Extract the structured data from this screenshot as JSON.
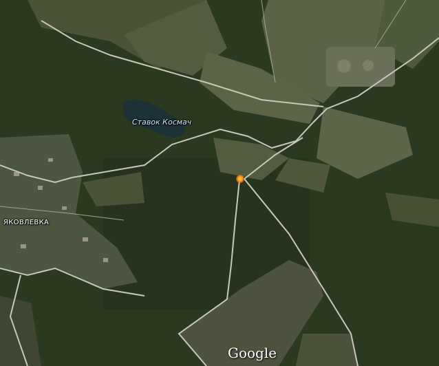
{
  "map": {
    "labels": {
      "water_body": "Ставок Космач",
      "village": "ЯКОВЛЕВКА"
    },
    "marker": {
      "icon": "location-marker-icon",
      "color": "#ff8a1a"
    },
    "attribution": "Google",
    "colors": {
      "forest": "#2d3a22",
      "field_light": "#5b6548",
      "field_dark": "#434c35",
      "road": "#c8c6bd",
      "water": "#1e3437"
    }
  }
}
